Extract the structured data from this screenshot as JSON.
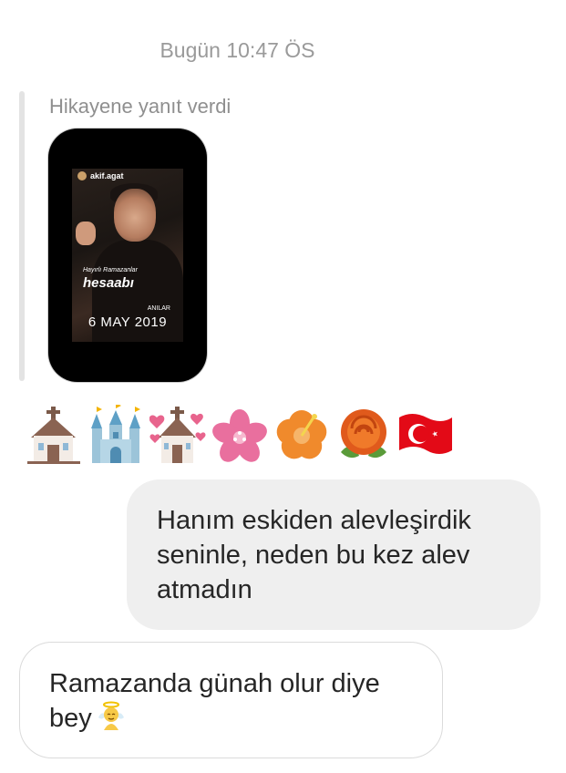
{
  "thread": {
    "timestamp": "Bugün 10:47 ÖS"
  },
  "story_reply": {
    "label": "Hikayene yanıt verdi",
    "story": {
      "username": "akif.agat",
      "caption_small": "Hayırlı Ramazanlar",
      "caption_big": "hesaabı",
      "tag": "ANILAR",
      "date": "6 MAY 2019"
    }
  },
  "emoji_message": {
    "emojis": [
      "church-icon",
      "castle-icon",
      "wedding-church-icon",
      "cherry-blossom-icon",
      "hibiscus-icon",
      "rose-icon",
      "turkey-flag-icon"
    ]
  },
  "messages": [
    {
      "side": "right",
      "text": "Hanım eskiden alevleşirdik seninle, neden bu kez alev atmadın"
    },
    {
      "side": "left",
      "text": "Ramazanda günah olur diye bey",
      "emoji": "angel-icon"
    }
  ],
  "colors": {
    "sent_bubble": "#efefef",
    "received_border": "#dbdbdb",
    "meta_text": "#9a9a9a",
    "turkey_red": "#e30a17"
  }
}
